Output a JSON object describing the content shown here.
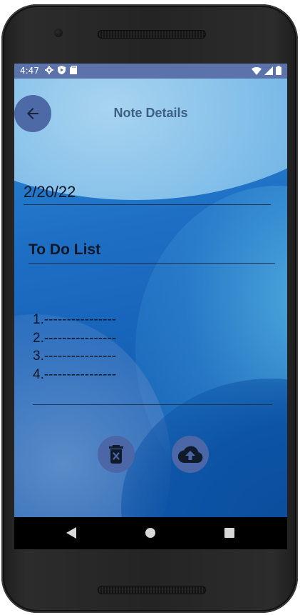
{
  "status_bar": {
    "time": "4:47",
    "left_icons": [
      "gear-icon",
      "play-protect-icon",
      "sd-card-icon"
    ],
    "right_icons": [
      "wifi-icon",
      "signal-icon",
      "battery-icon"
    ]
  },
  "header": {
    "title": "Note Details",
    "back_icon": "arrow-left-icon"
  },
  "note": {
    "date": "2/20/22",
    "title": "To Do List",
    "body_lines": [
      "1.----------------",
      "2.----------------",
      "3.----------------",
      "4.----------------"
    ]
  },
  "actions": {
    "delete_icon": "trash-x-icon",
    "upload_icon": "cloud-upload-icon"
  },
  "nav_bar": {
    "icons": [
      "nav-back-icon",
      "nav-home-icon",
      "nav-recents-icon"
    ]
  },
  "colors": {
    "status_bar": "#5b72aa",
    "accent_button": "#4b67a8",
    "title_text": "#3d5f86",
    "text": "#0c1626"
  }
}
